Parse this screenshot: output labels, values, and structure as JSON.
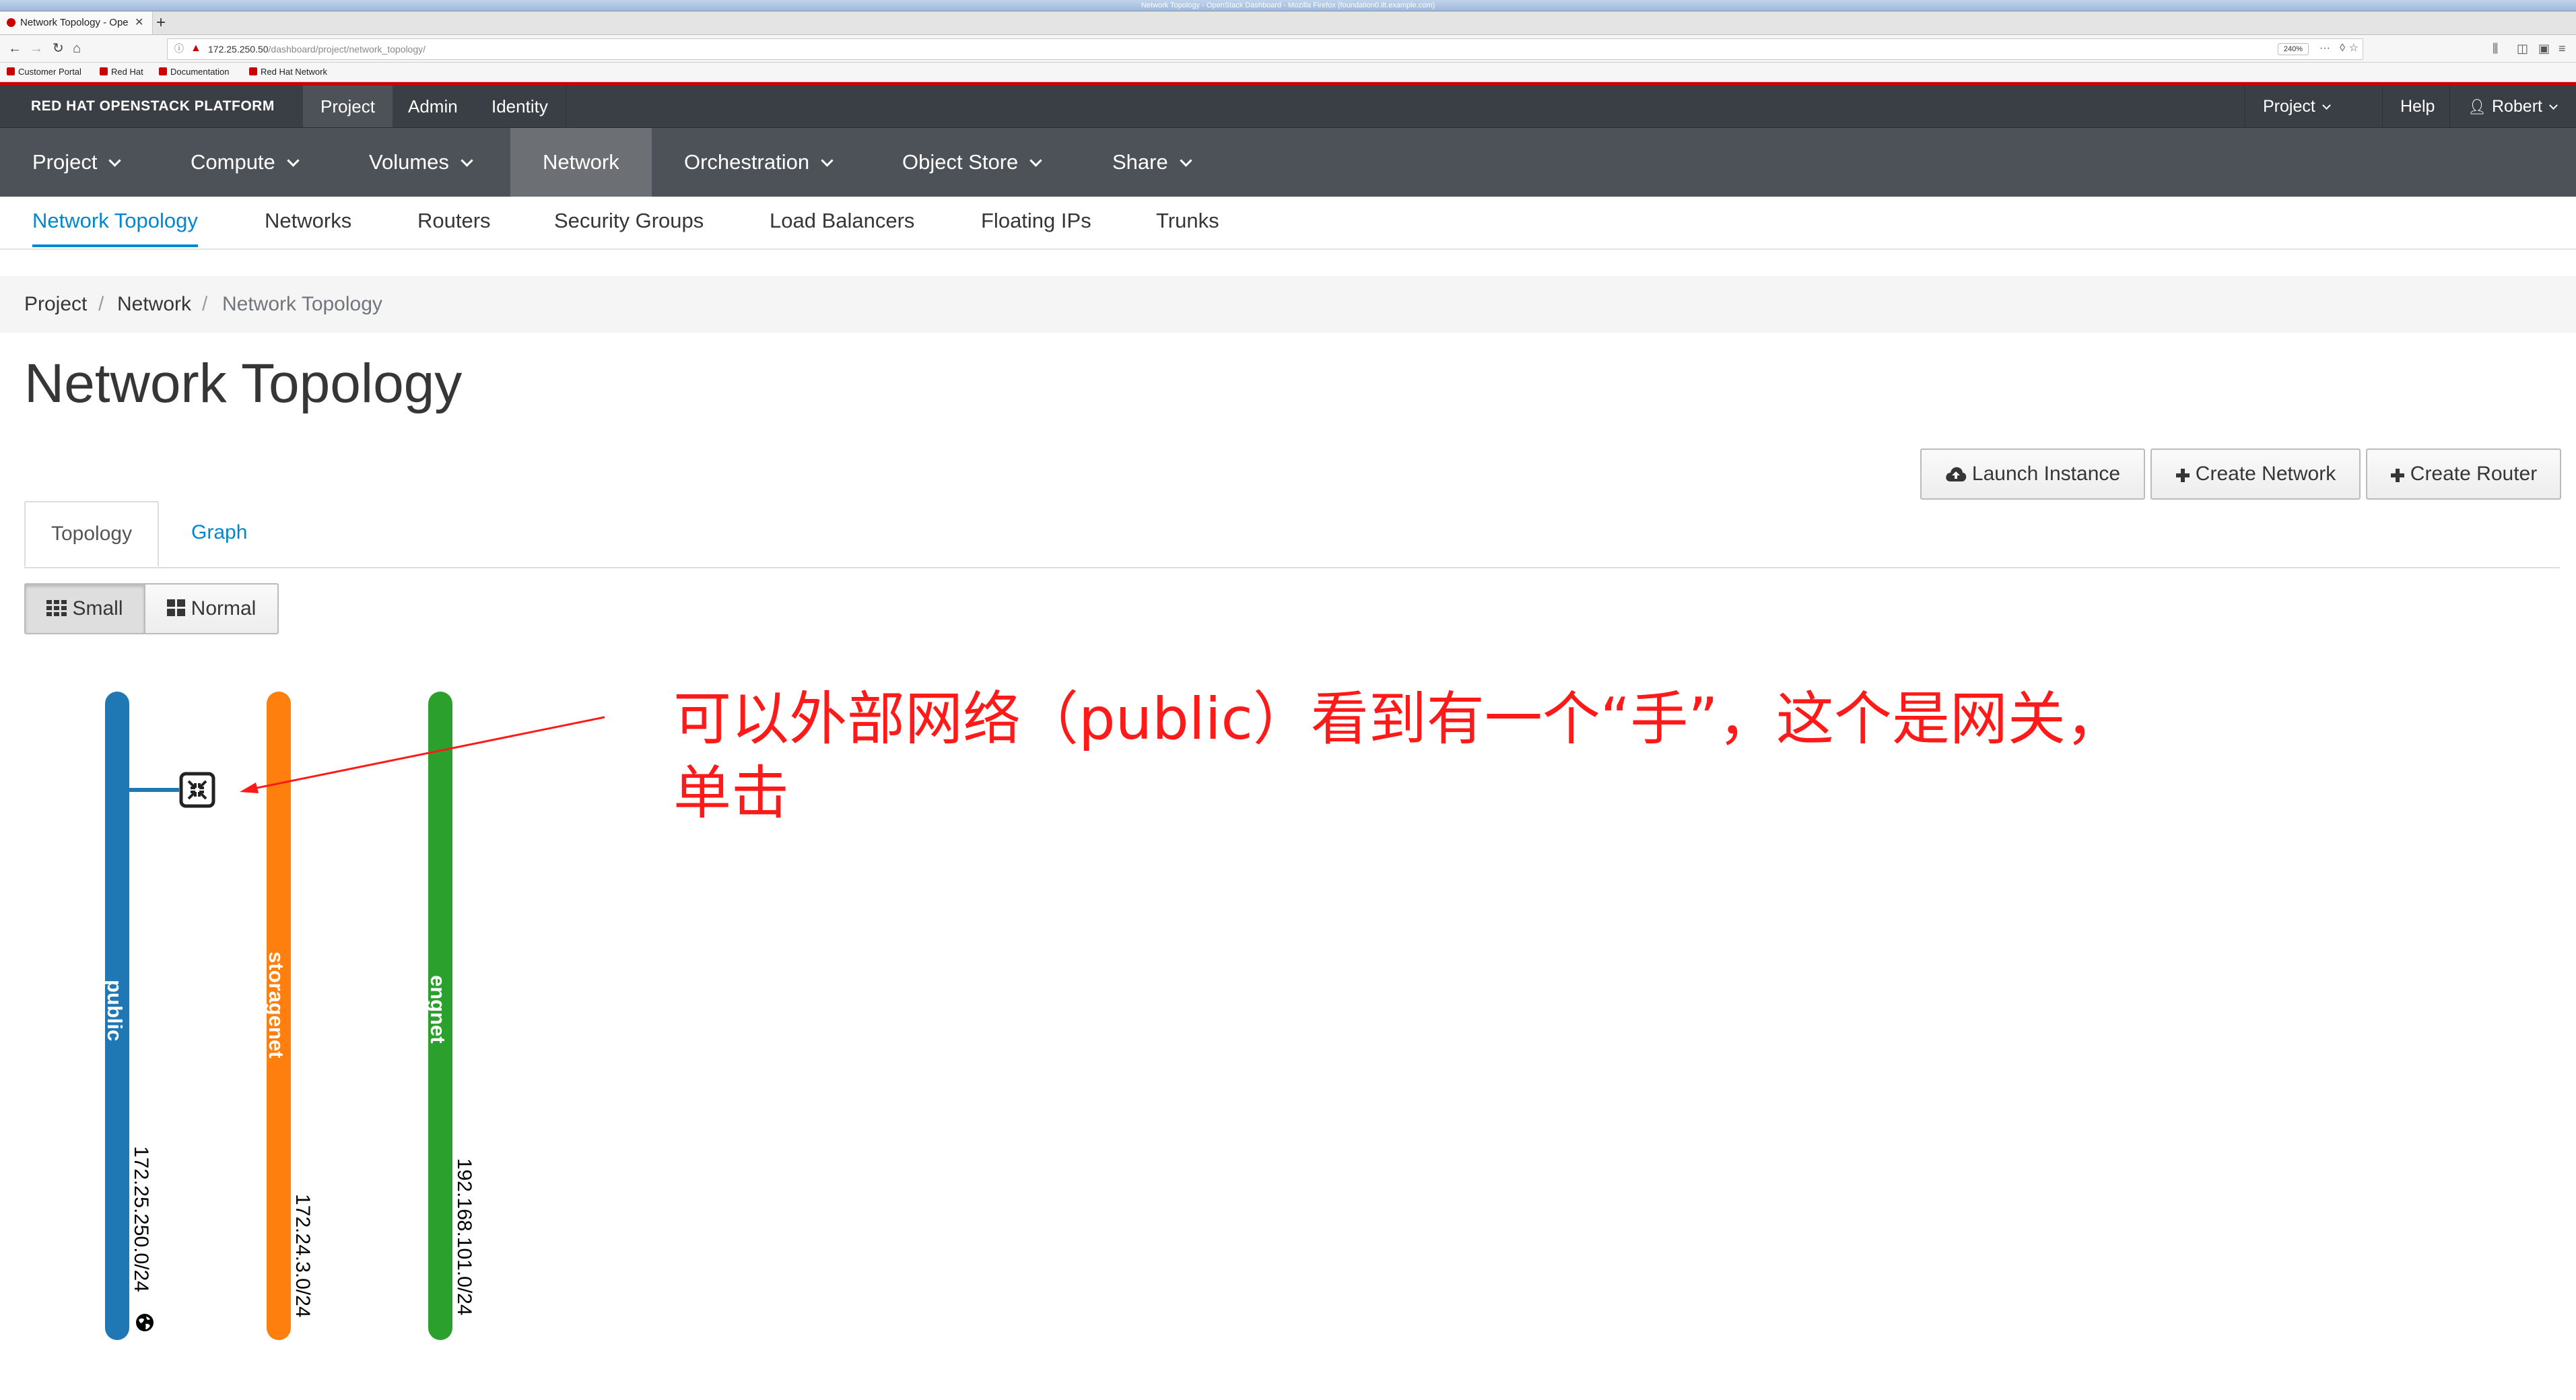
{
  "browser": {
    "window_title": "Network Topology - OpenStack Dashboard - Mozilla Firefox (foundation0.ilt.example.com)",
    "tab_title": "Network Topology - Ope",
    "url_host": "172.25.250.50",
    "url_path": "/dashboard/project/network_topology/",
    "zoom": "240%",
    "bookmarks": [
      "Customer Portal",
      "Red Hat",
      "Documentation",
      "Red Hat Network"
    ]
  },
  "masthead": {
    "brand": "RED HAT OPENSTACK PLATFORM",
    "tabs": [
      "Project",
      "Admin",
      "Identity"
    ],
    "active_tab": "Project",
    "right": {
      "project": "Project",
      "help": "Help",
      "user": "Robert"
    }
  },
  "main_nav": {
    "items": [
      "Project",
      "Compute",
      "Volumes",
      "Network",
      "Orchestration",
      "Object Store",
      "Share"
    ],
    "active": "Network"
  },
  "sub_nav": {
    "items": [
      "Network Topology",
      "Networks",
      "Routers",
      "Security Groups",
      "Load Balancers",
      "Floating IPs",
      "Trunks"
    ],
    "active": "Network Topology"
  },
  "breadcrumb": [
    "Project",
    "Network",
    "Network Topology"
  ],
  "page_title": "Network Topology",
  "actions": {
    "launch_instance": "Launch Instance",
    "create_network": "Create Network",
    "create_router": "Create Router"
  },
  "view_tabs": {
    "topology": "Topology",
    "graph": "Graph",
    "active": "Topology"
  },
  "size_toggle": {
    "small": "Small",
    "normal": "Normal",
    "active": "Small"
  },
  "networks": [
    {
      "name": "public",
      "cidr": "172.25.250.0/24",
      "color": "#1f77b4",
      "external": true
    },
    {
      "name": "storagenet",
      "cidr": "172.24.3.0/24",
      "color": "#ff7f0e",
      "external": false
    },
    {
      "name": "engnet",
      "cidr": "192.168.101.0/24",
      "color": "#2ca02c",
      "external": false
    }
  ],
  "annotation": {
    "line1": "可以外部网络（public）看到有一个“手”，这个是网关，",
    "line2": "单击",
    "color": "#ff1a1a"
  }
}
